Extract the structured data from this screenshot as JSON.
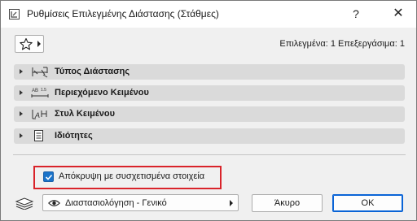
{
  "window": {
    "title": "Ρυθμίσεις Επιλεγμένης Διάστασης (Στάθμες)",
    "help_label": "?",
    "close_label": "✕"
  },
  "toolbar": {
    "favorites_icon": "star-icon",
    "status_text": "Επιλεγμένα: 1 Επεξεργάσιμα: 1"
  },
  "panels": [
    {
      "label": "Τύπος Διάστασης",
      "icon": "dimension-type-icon"
    },
    {
      "label": "Περιεχόμενο Κειμένου",
      "icon": "text-content-icon"
    },
    {
      "label": "Στυλ Κειμένου",
      "icon": "text-style-icon"
    },
    {
      "label": "Ιδιότητες",
      "icon": "properties-icon"
    }
  ],
  "options": {
    "hide_associated": {
      "label": "Απόκρυψη με συσχετισμένα στοιχεία",
      "checked": true
    }
  },
  "footer": {
    "view_select_value": "Διαστασιολόγηση - Γενικό",
    "cancel_label": "Άκυρο",
    "ok_label": "OK"
  },
  "colors": {
    "accent": "#1a73c9",
    "highlight_border": "#d9232a",
    "panel_bg": "#dadada"
  }
}
